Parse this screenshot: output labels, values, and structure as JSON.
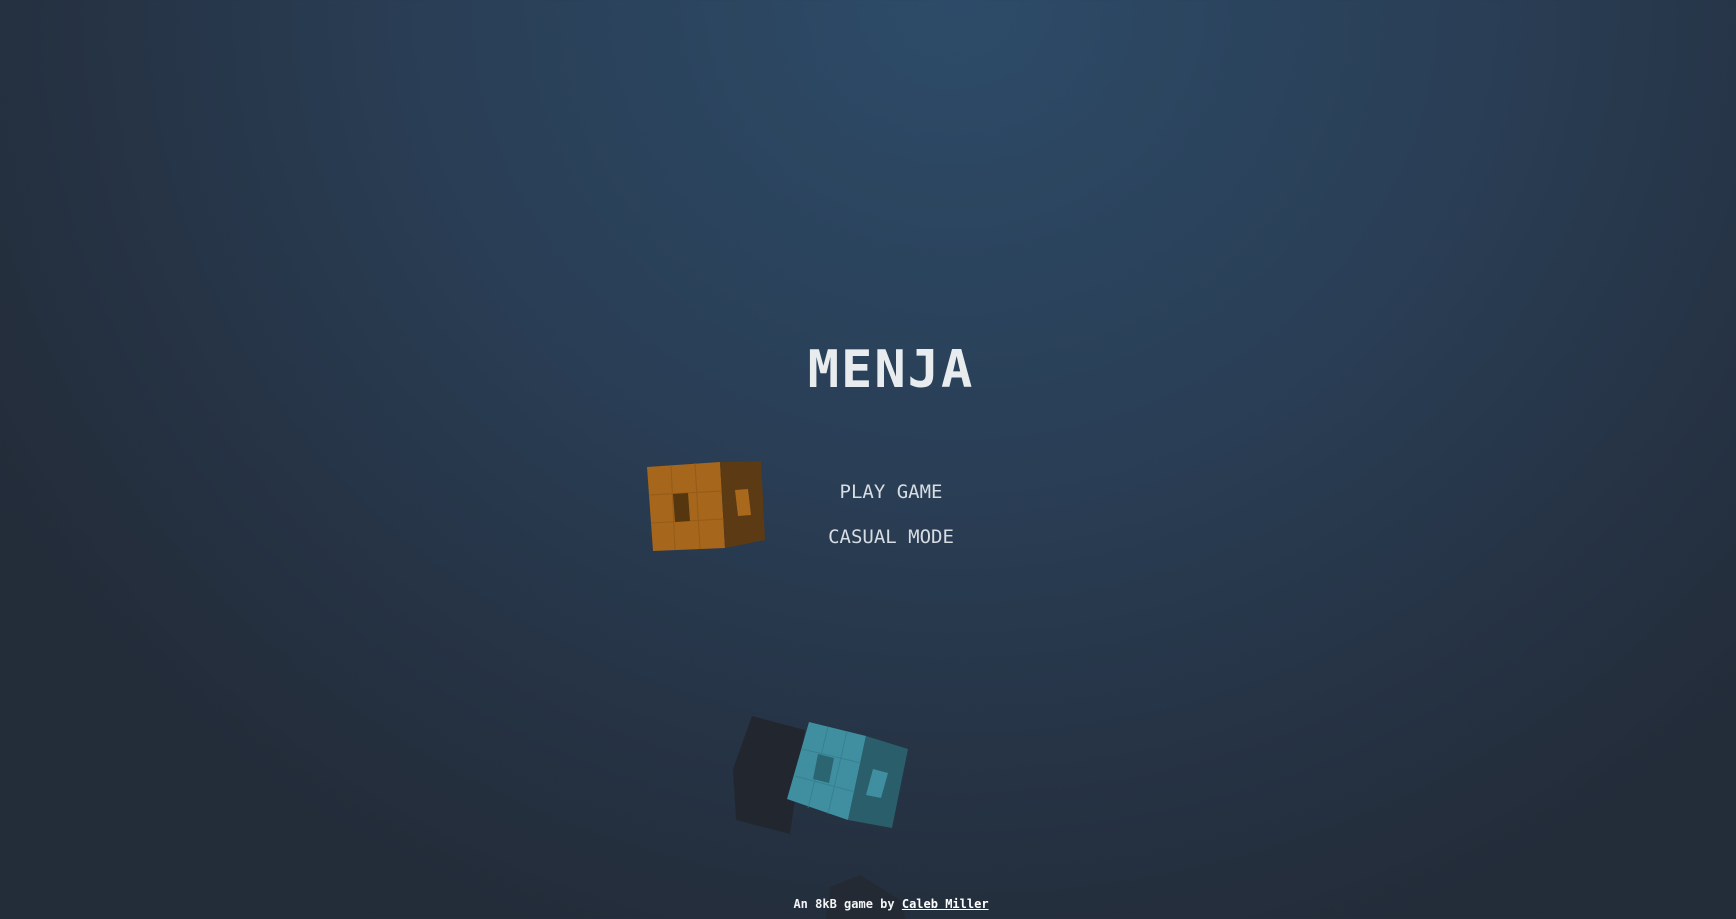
{
  "game": {
    "title": "MENJA"
  },
  "menu": {
    "items": [
      {
        "label": "PLAY GAME"
      },
      {
        "label": "CASUAL MODE"
      }
    ]
  },
  "footer": {
    "prefix": "An 8kB game by",
    "author": "Caleb Miller"
  },
  "colors": {
    "orange_face": "#a6661b",
    "orange_side": "#5c3a13",
    "blue_face": "#3f8fa1",
    "blue_side": "#2a5e6b",
    "dark_cube": "#22272f"
  },
  "icons": {
    "orange_cube": "orange-cube-icon",
    "blue_cube": "blue-cube-icon",
    "dark_cube": "dark-cube-icon"
  }
}
